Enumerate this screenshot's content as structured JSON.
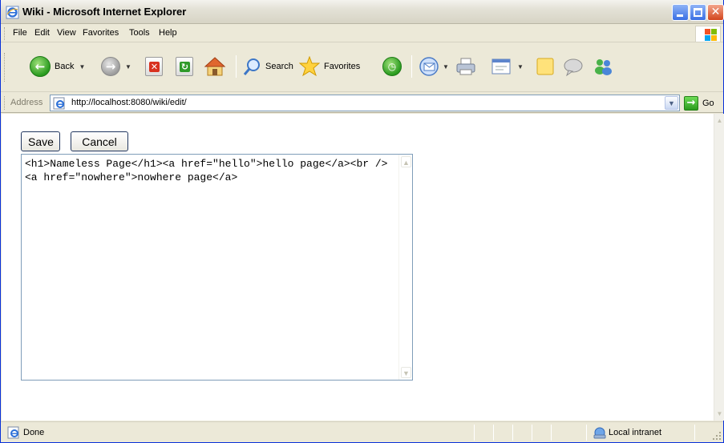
{
  "window": {
    "title": "Wiki - Microsoft Internet Explorer"
  },
  "menu": {
    "items": [
      "File",
      "Edit",
      "View",
      "Favorites",
      "Tools",
      "Help"
    ]
  },
  "toolbar": {
    "back_label": "Back",
    "search_label": "Search",
    "favorites_label": "Favorites"
  },
  "address": {
    "label": "Address",
    "url": "http://localhost:8080/wiki/edit/",
    "go_label": "Go"
  },
  "page": {
    "save_label": "Save",
    "cancel_label": "Cancel",
    "editor_content": "<h1>Nameless Page</h1><a href=\"hello\">hello page</a><br /><a href=\"nowhere\">nowhere page</a>"
  },
  "status": {
    "text": "Done",
    "zone": "Local intranet"
  },
  "colors": {
    "title_bar": "#e3e1d6",
    "chrome": "#ece9d8",
    "address_border": "#7f9db9",
    "button_border": "#21365f"
  }
}
